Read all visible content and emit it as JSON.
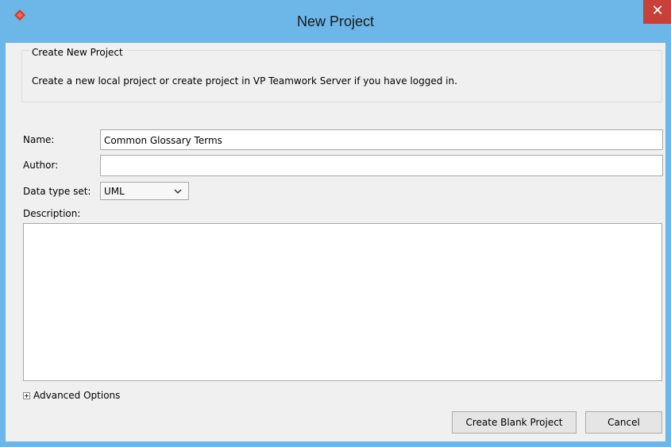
{
  "window": {
    "title": "New Project",
    "close_glyph": "✕",
    "app_icon": "visual-paradigm-logo-icon"
  },
  "group": {
    "legend": "Create New Project",
    "description": "Create a new local project or create project in VP Teamwork Server if you have logged in."
  },
  "form": {
    "name_label": "Name:",
    "name_value": "Common Glossary Terms",
    "author_label": "Author:",
    "author_value": "",
    "datatype_label": "Data type set:",
    "datatype_value": "UML",
    "description_label": "Description:",
    "description_value": ""
  },
  "advanced": {
    "label": "Advanced Options"
  },
  "buttons": {
    "create_label": "Create Blank Project",
    "cancel_label": "Cancel"
  },
  "colors": {
    "titlebar": "#6cb6e8",
    "close": "#c7403a",
    "dialog_bg": "#f0f0f0"
  }
}
